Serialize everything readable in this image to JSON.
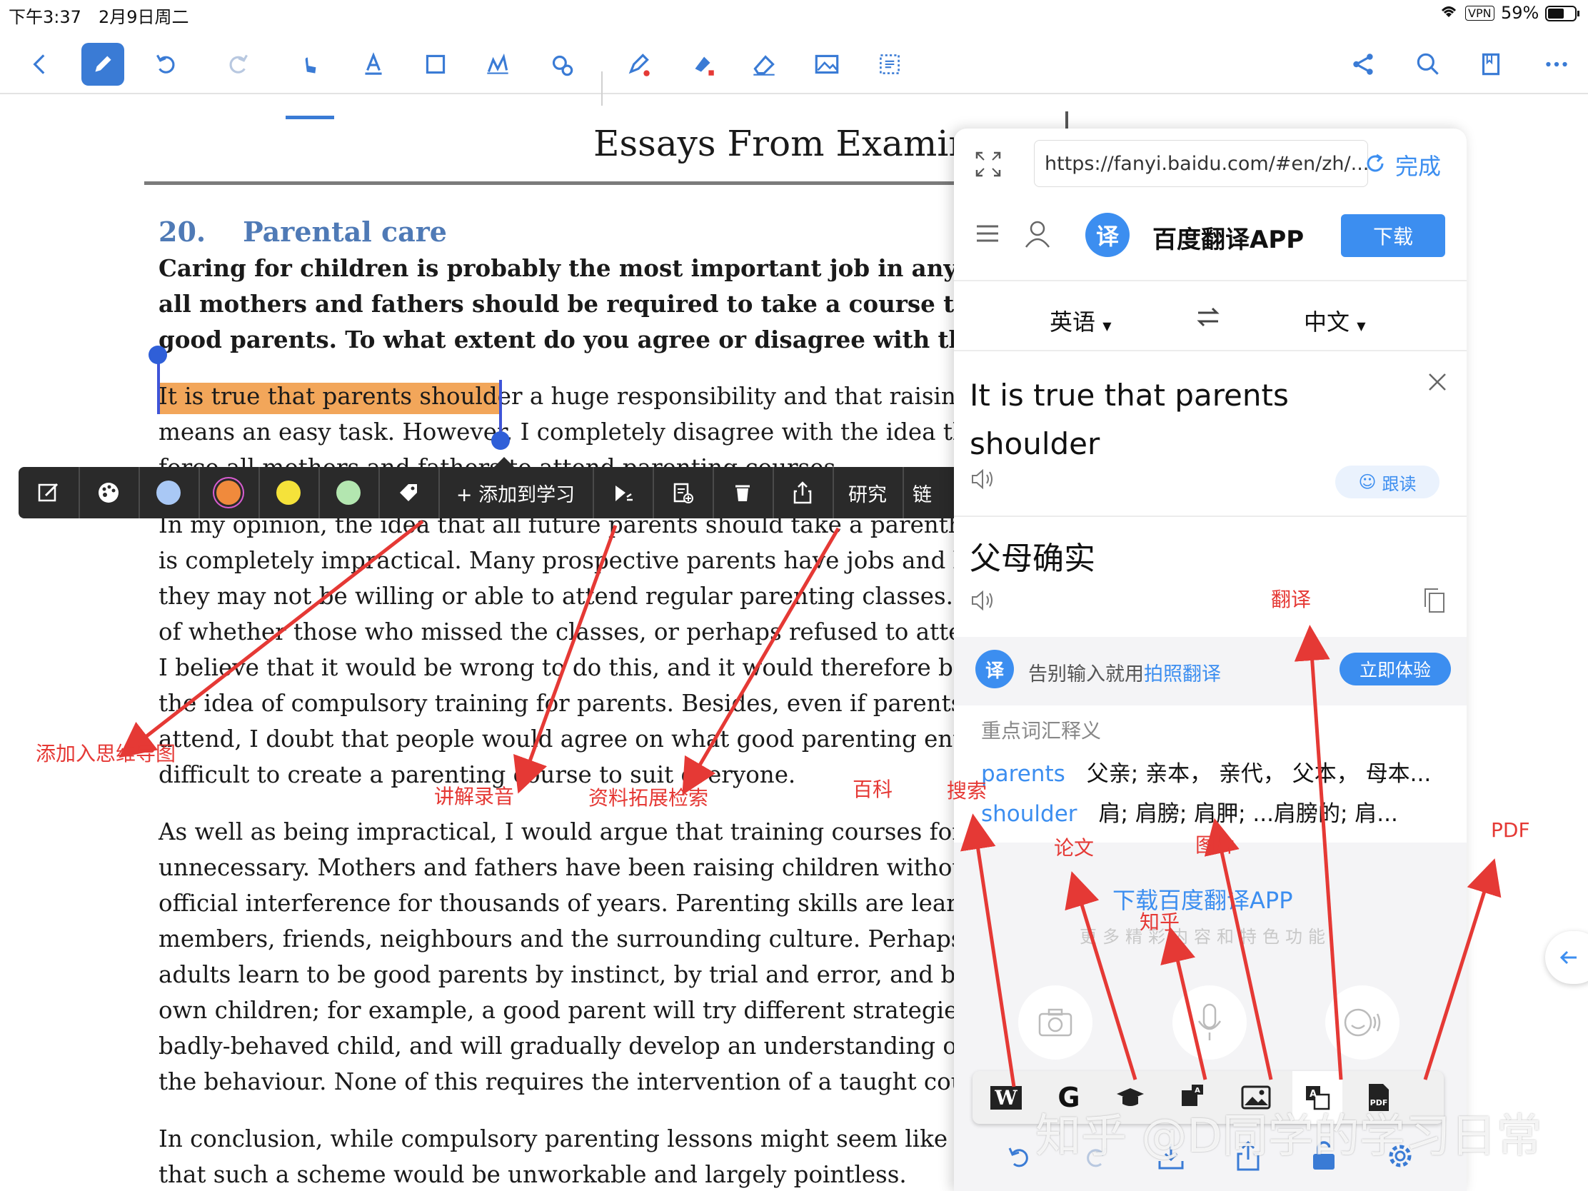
{
  "status_bar": {
    "time": "下午3:37",
    "date": "2月9日周二",
    "vpn": "VPN",
    "battery": "59%"
  },
  "toolbar": {
    "icons": [
      "back-icon",
      "pen-icon",
      "undo-icon",
      "redo-icon",
      "hand-pointer-icon",
      "text-icon",
      "crop-icon",
      "signature-icon",
      "settings-gear-icon",
      "highlighter-icon",
      "fill-icon",
      "eraser-icon",
      "image-icon",
      "select-icon",
      "share-nodes-icon",
      "search-icon",
      "bookmark-icon",
      "more-icon"
    ],
    "accent": "#3a7bd5"
  },
  "document": {
    "title": "Essays From Examine",
    "section_number": "20.",
    "section_title": "Parental care",
    "prompt_lines": [
      "Caring for children is probably the most important job in any socie",
      "all mothers and fathers should be required to take a course that pr",
      "good parents. To what extent do you agree or disagree with this vi"
    ],
    "p1_line1_highlight": "It is true that parents shoulder",
    "p1_line1_rest": " a huge responsibility and that raising ch",
    "p1_line2": "means an easy task. However, I completely disagree with the idea that w",
    "p1_line3": "force all mothers and fathers to attend parenting courses.",
    "p2_lines": [
      "In my opinion, the idea that all future parents should take a parenthood",
      "is completely impractical. Many prospective parents have jobs and busy",
      "they may not be willing or able to attend regular parenting classes. This",
      "of whether those who missed the classes, or perhaps refused to attend,",
      "I believe that it would be wrong to do this, and it would therefore be im",
      "the idea of compulsory training for parents. Besides, even if parents cou",
      "attend, I doubt that people would agree on what good parenting entails",
      "difficult to create a parenting course to suit everyone."
    ],
    "p3_lines": [
      "As well as being impractical, I would argue that training courses for par",
      "unnecessary. Mothers and fathers have been raising children without a",
      "official interference for thousands of years. Parenting skills are learnt fr",
      "members, friends, neighbours and the surrounding culture. Perhaps mo",
      "adults learn to be good parents by instinct, by trial and error, and by ge",
      "own children; for example, a good parent will try different strategies w",
      "badly-behaved child, and will gradually develop an understanding of w",
      "the behaviour. None of this requires the intervention of a taught course"
    ],
    "p4_lines": [
      "In conclusion, while compulsory parenting lessons might seem like a go",
      "that such a scheme would be unworkable and largely pointless."
    ]
  },
  "context_toolbar": {
    "add_to_study": "+ 添加到学习",
    "research": "研究",
    "link": "链",
    "swatches": [
      "#a9c8f5",
      "#f08a3c",
      "#f5e23a",
      "#b3e6b0"
    ]
  },
  "translate_panel": {
    "url": "https://fanyi.baidu.com/#en/zh/...",
    "done": "完成",
    "app_name": "百度翻译APP",
    "download": "下载",
    "source_lang": "英语",
    "target_lang": "中文",
    "source_text_line1": "It is true that parents",
    "source_text_line2": "shoulder",
    "follow_read": "跟读",
    "translation": "父母确实",
    "promo_text_prefix": "告别输入就用",
    "promo_link": "拍照翻译",
    "try_now": "立即体验",
    "vocab_heading": "重点词汇释义",
    "vocab": [
      {
        "word": "parents",
        "meaning": "父亲; 亲本， 亲代， 父本， 母本..."
      },
      {
        "word": "shoulder",
        "meaning": "肩; 肩膀; 肩胛; ...肩膀的; 肩..."
      }
    ],
    "download_app_link": "下载百度翻译APP",
    "more_features": "更多精彩内容和特色功能",
    "accent": "#3c8ef0"
  },
  "annotations": {
    "mindmap": "添加入思维导图",
    "audio": "讲解录音",
    "resource": "资料拓展检索",
    "baike": "百科",
    "search": "搜索",
    "translate": "翻译",
    "paper": "论文",
    "image": "图片",
    "zhihu": "知乎",
    "pdf": "PDF",
    "color": "#e53935"
  },
  "search_bar": {
    "icons": [
      "wikipedia-icon",
      "google-icon",
      "scholar-cap-icon",
      "image-search-icon",
      "picture-icon",
      "translate-icon",
      "pdf-icon"
    ],
    "wiki_label": "W",
    "google_label": "G"
  },
  "bottom_tools": {
    "icons": [
      "undo-icon",
      "redo-icon",
      "download-icon",
      "share-icon",
      "lock-icon",
      "settings-icon"
    ]
  },
  "watermark": "知乎 @D同学的学习日常"
}
